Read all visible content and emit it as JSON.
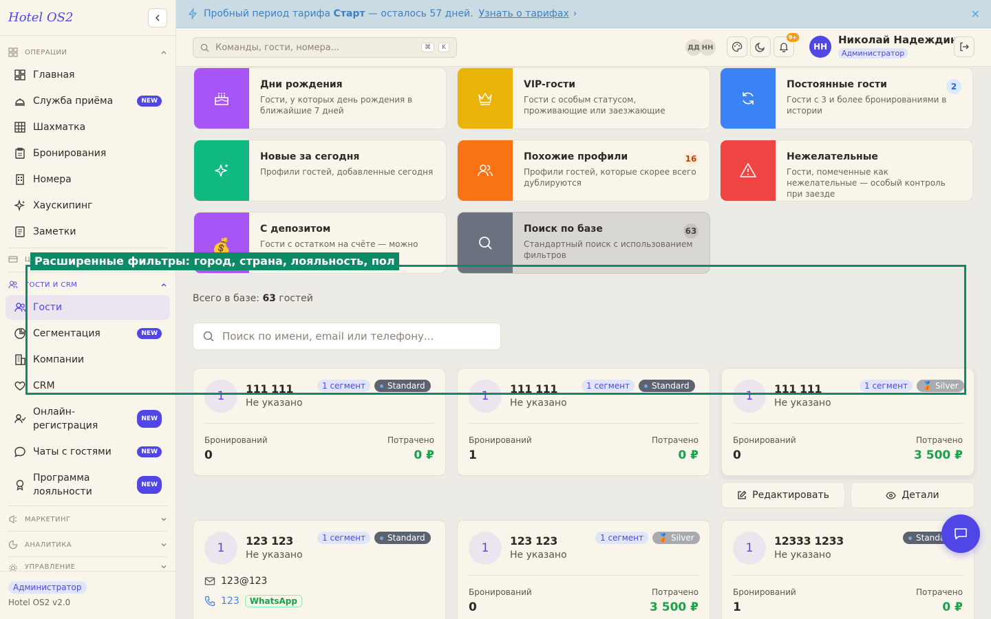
{
  "app": {
    "logo": "Hotel OS2"
  },
  "sidebar": {
    "sections": [
      {
        "label": "ОПЕРАЦИИ"
      },
      {
        "label": "Ц"
      },
      {
        "label": "ГОСТИ И CRM"
      },
      {
        "label": "МАРКЕТИНГ"
      },
      {
        "label": "АНАЛИТИКА"
      },
      {
        "label": "УПРАВЛЕНИЕ"
      }
    ],
    "ops_items": [
      {
        "label": "Главная"
      },
      {
        "label": "Служба приёма",
        "badge": "NEW"
      },
      {
        "label": "Шахматка"
      },
      {
        "label": "Бронирования"
      },
      {
        "label": "Номера"
      },
      {
        "label": "Хаускипинг"
      },
      {
        "label": "Заметки"
      }
    ],
    "crm_items": [
      {
        "label": "Гости"
      },
      {
        "label": "Сегментация",
        "badge": "NEW"
      },
      {
        "label": "Компании"
      },
      {
        "label": "CRM"
      },
      {
        "label": "Онлайн-регистрация",
        "badge": "NEW"
      },
      {
        "label": "Чаты с гостями",
        "badge": "NEW"
      },
      {
        "label": "Программа лояльности",
        "badge": "NEW"
      }
    ],
    "footer": {
      "role": "Администратор",
      "version": "Hotel OS2 v2.0"
    }
  },
  "banner": {
    "text_pre": "Пробный период тарифа",
    "plan": "Старт",
    "text_post": "— осталось 57 дней.",
    "link": "Узнать о тарифах",
    "link_arrow": "›",
    "close": "✕"
  },
  "header": {
    "search_placeholder": "Команды, гости, номера...",
    "kbd1": "⌘",
    "kbd2": "K",
    "mini_avatars": [
      "ДД",
      "НН"
    ],
    "notif_count": "9+",
    "user": {
      "initials": "НН",
      "name": "Николай Надеждин",
      "role": "Администратор"
    }
  },
  "segments": [
    {
      "title": "Дни рождения",
      "desc": "Гости, у которых день рождения в ближайшие 7 дней",
      "color": "#a855f7",
      "icon": "cake-icon"
    },
    {
      "title": "VIP-гости",
      "desc": "Гости с особым статусом, проживающие или заезжающие",
      "color": "#eab308",
      "icon": "crown-icon"
    },
    {
      "title": "Постоянные гости",
      "desc": "Гости с 3 и более бронированиями в истории",
      "count": "2",
      "color": "#3b82f6",
      "icon": "refresh-icon"
    },
    {
      "title": "Новые за сегодня",
      "desc": "Профили гостей, добавленные сегодня",
      "color": "#10b981",
      "icon": "sparkles-icon"
    },
    {
      "title": "Похожие профили",
      "desc": "Профили гостей, которые скорее всего дублируются",
      "count": "16",
      "color": "#f97316",
      "icon": "users-icon"
    },
    {
      "title": "Нежелательные",
      "desc": "Гости, помеченные как нежелательные — особый контроль при заезде",
      "color": "#ef4444",
      "icon": "warning-icon"
    },
    {
      "title": "С депозитом",
      "desc": "Гости с остатком на счёте — можно",
      "color": "#a855f7",
      "icon": "money-bag-icon",
      "emoji": "💰"
    },
    {
      "title": "Поиск по базе",
      "desc": "Стандартный поиск с использованием фильтров",
      "count": "63",
      "color": "#6b7280",
      "icon": "search-icon"
    }
  ],
  "total": {
    "prefix": "Всего в базе:",
    "count": "63",
    "suffix": "гостей"
  },
  "guest_search": {
    "placeholder": "Поиск по имени, email или телефону..."
  },
  "guests": [
    {
      "initial": "1",
      "name": "111 111",
      "sub": "Не указано",
      "segments": "1 сегмент",
      "level": "Standard",
      "bookings_label": "Бронирований",
      "bookings": "0",
      "spent_label": "Потрачено",
      "spent": "0 ₽"
    },
    {
      "initial": "1",
      "name": "111 111",
      "sub": "Не указано",
      "segments": "1 сегмент",
      "level": "Standard",
      "bookings_label": "Бронирований",
      "bookings": "1",
      "spent_label": "Потрачено",
      "spent": "0 ₽"
    },
    {
      "initial": "1",
      "name": "111 111",
      "sub": "Не указано",
      "segments": "1 сегмент",
      "level": "Silver",
      "bookings_label": "Бронирований",
      "bookings": "0",
      "spent_label": "Потрачено",
      "spent": "3 500 ₽"
    },
    {
      "initial": "1",
      "name": "123 123",
      "sub": "Не указано",
      "segments": "1 сегмент",
      "level": "Standard",
      "email": "123@123",
      "phone": "123",
      "messenger": "WhatsApp"
    },
    {
      "initial": "1",
      "name": "123 123",
      "sub": "Не указано",
      "segments": "1 сегмент",
      "level": "Silver",
      "bookings_label": "Бронирований",
      "bookings": "0",
      "spent_label": "Потрачено",
      "spent": "3 500 ₽"
    },
    {
      "initial": "1",
      "name": "12333 1233",
      "sub": "Не указано",
      "level": "Standard",
      "bookings_label": "Бронирований",
      "bookings": "1",
      "spent_label": "Потрачено",
      "spent": "0 ₽"
    }
  ],
  "actions": {
    "edit": "Редактировать",
    "details": "Детали"
  },
  "tooltip": {
    "text": "Расширенные фильтры: город, страна, лояльность, пол"
  }
}
